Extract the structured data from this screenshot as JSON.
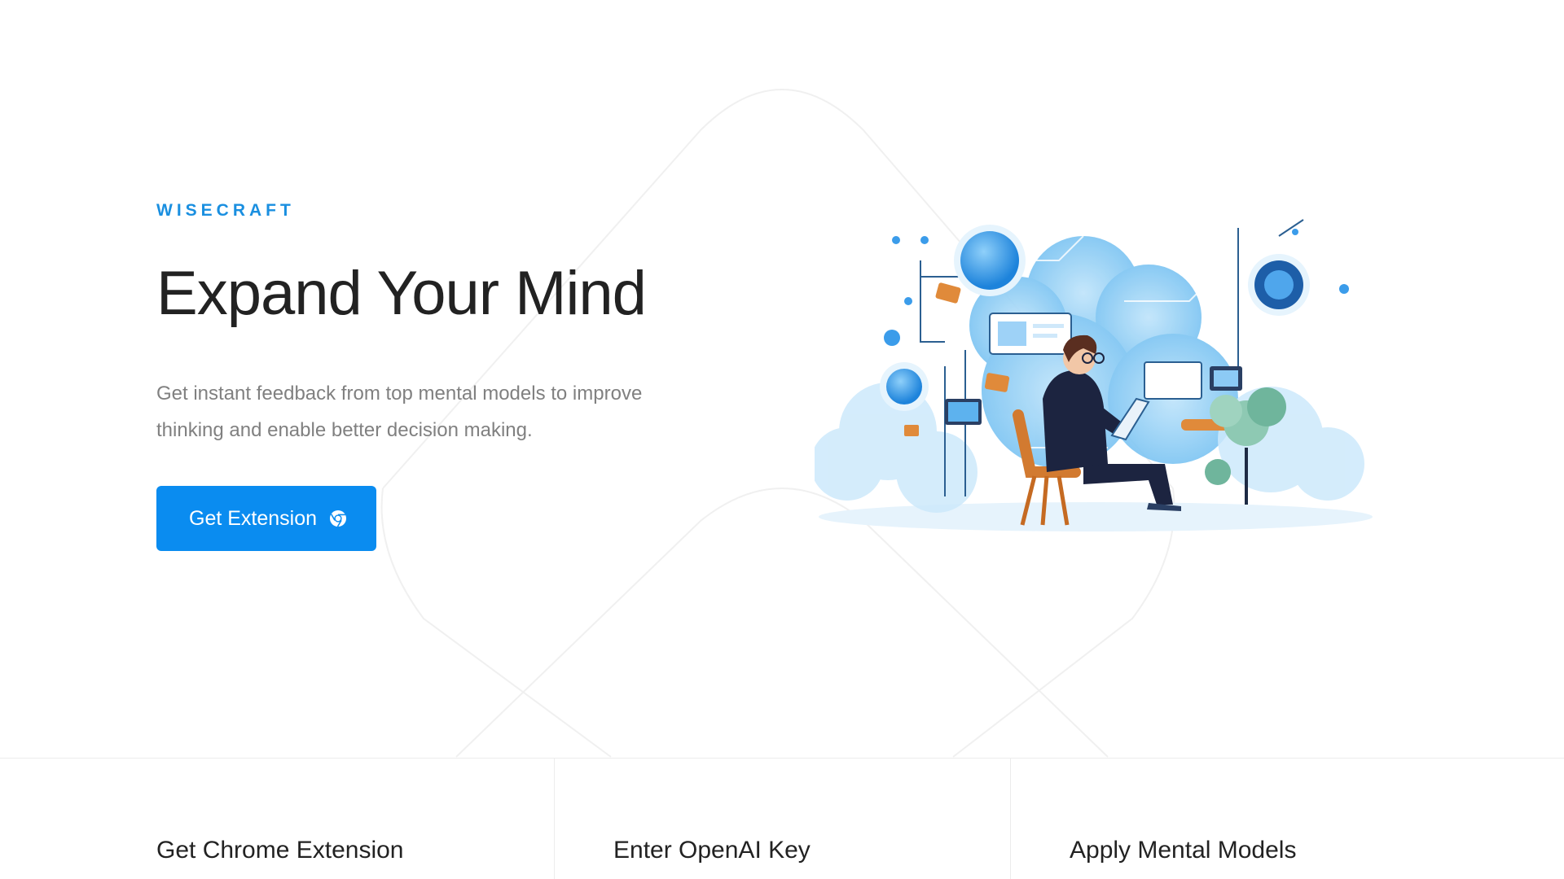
{
  "hero": {
    "brand": "WISECRAFT",
    "headline": "Expand Your Mind",
    "subtext_line1": "Get instant feedback from top mental models to improve",
    "subtext_line2": "thinking and enable better decision making.",
    "cta_label": "Get Extension",
    "cta_icon": "chrome-icon"
  },
  "steps": [
    {
      "title": "Get Chrome Extension"
    },
    {
      "title": "Enter OpenAI Key"
    },
    {
      "title": "Apply Mental Models"
    }
  ],
  "colors": {
    "accent": "#0a8cf0",
    "brand": "#1a8fe0",
    "text": "#222222",
    "muted": "#808080"
  }
}
